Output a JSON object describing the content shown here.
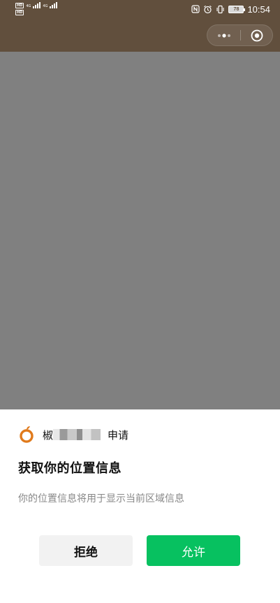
{
  "status_bar": {
    "network_row1": {
      "hd": "HD",
      "label": "4G"
    },
    "network_row2": {
      "hd": "HD",
      "label": "4G"
    },
    "battery_level": "78",
    "time": "10:54",
    "icons": [
      "nfc-icon",
      "alarm-icon",
      "vibrate-icon",
      "battery-icon"
    ]
  },
  "capsule": {
    "more_icon": "more-dots-icon",
    "close_icon": "close-target-icon"
  },
  "sheet": {
    "app_name_prefix": "椒",
    "apply_text": "申请",
    "title": "获取你的位置信息",
    "description": "你的位置信息将用于显示当前区域信息",
    "deny_label": "拒绝",
    "allow_label": "允许"
  },
  "colors": {
    "header_bg": "#614f3d",
    "overlay": "#808080",
    "allow_green": "#07c160",
    "deny_bg": "#f2f2f2",
    "logo_orange": "#e07a1c"
  }
}
